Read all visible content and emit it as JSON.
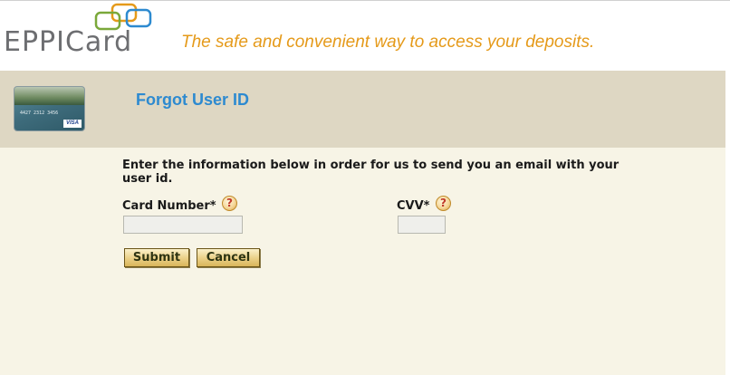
{
  "header": {
    "logo_text": "EPPICard",
    "tagline": "The safe and convenient way to access your deposits."
  },
  "band": {
    "title": "Forgot User ID",
    "card_image": {
      "number_text": "4427 2312 3456",
      "brand": "VISA"
    }
  },
  "form": {
    "instructions": "Enter the information below in order for us to send you an email with your user id.",
    "card_number": {
      "label": "Card Number*",
      "value": "",
      "help": "?"
    },
    "cvv": {
      "label": "CVV*",
      "value": "",
      "help": "?"
    },
    "submit_label": "Submit",
    "cancel_label": "Cancel"
  },
  "colors": {
    "tagline": "#e59a1a",
    "title": "#2d8ad0",
    "band_bg": "#ded7c3",
    "content_bg": "#f7f4e6"
  }
}
